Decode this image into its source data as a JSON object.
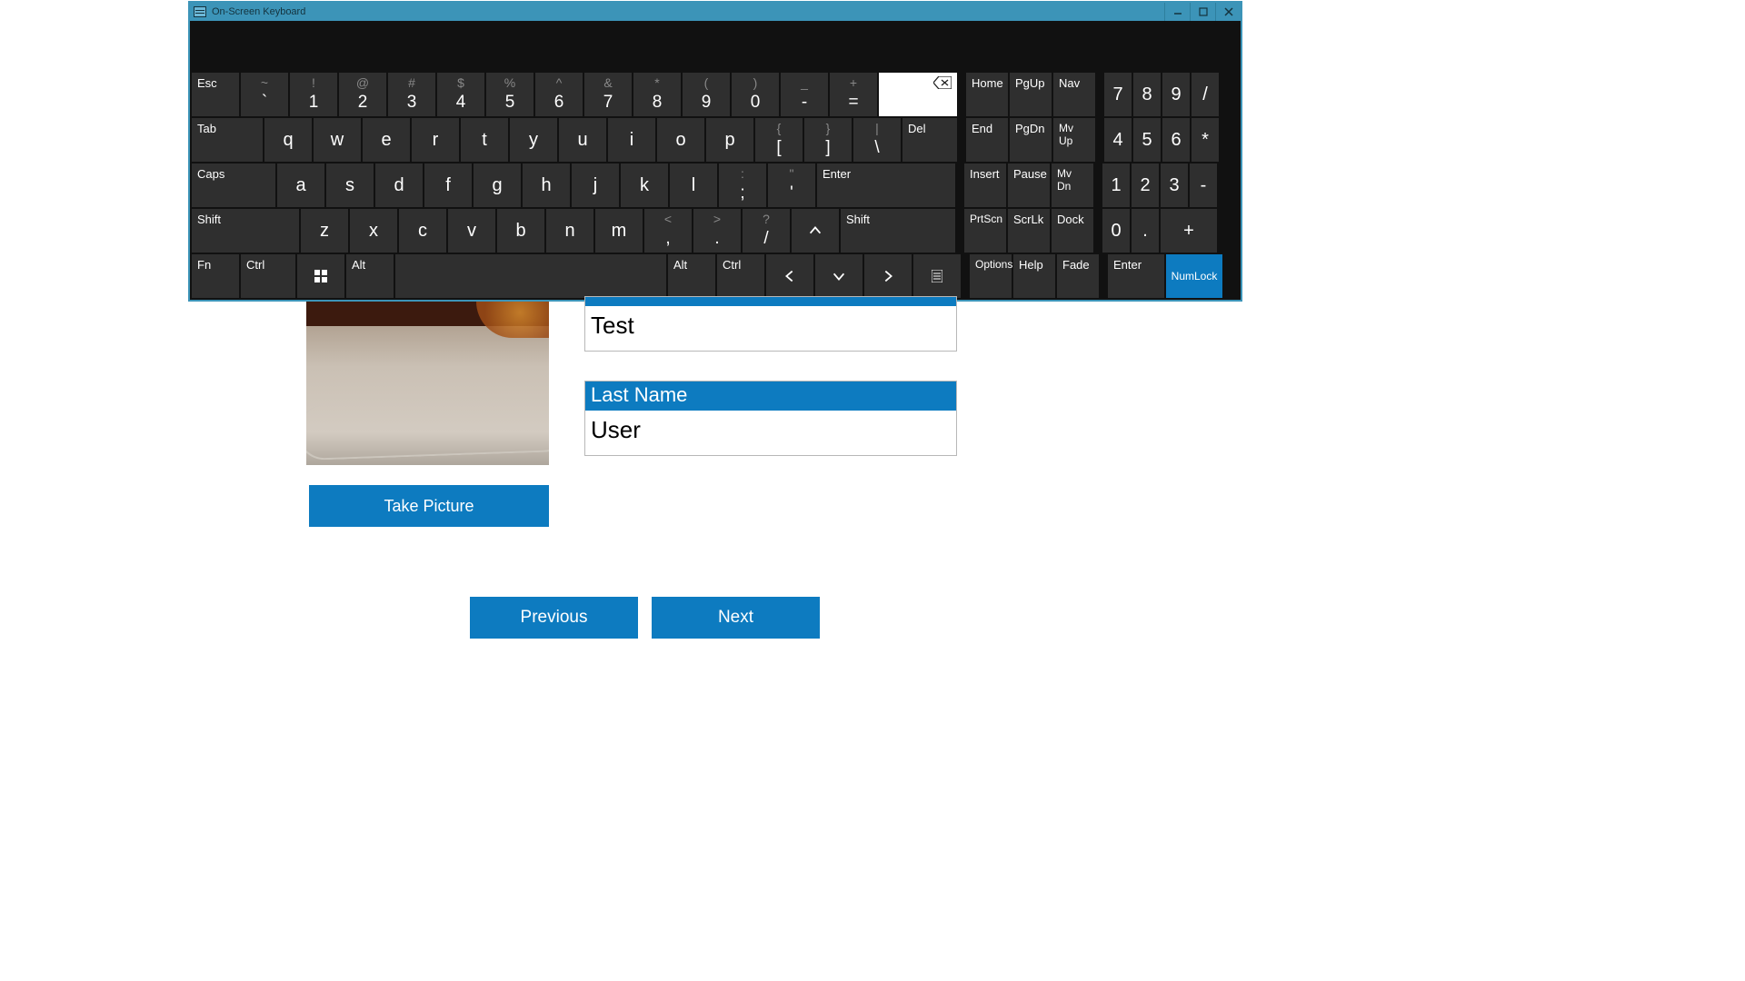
{
  "osk": {
    "title": "On-Screen Keyboard",
    "row1": {
      "esc": "Esc",
      "nums": [
        {
          "top": "~",
          "bot": "`"
        },
        {
          "top": "!",
          "bot": "1"
        },
        {
          "top": "@",
          "bot": "2"
        },
        {
          "top": "#",
          "bot": "3"
        },
        {
          "top": "$",
          "bot": "4"
        },
        {
          "top": "%",
          "bot": "5"
        },
        {
          "top": "^",
          "bot": "6"
        },
        {
          "top": "&",
          "bot": "7"
        },
        {
          "top": "*",
          "bot": "8"
        },
        {
          "top": "(",
          "bot": "9"
        },
        {
          "top": ")",
          "bot": "0"
        },
        {
          "top": "_",
          "bot": "-"
        },
        {
          "top": "+",
          "bot": "="
        }
      ],
      "nav": {
        "home": "Home",
        "pgup": "PgUp",
        "nav": "Nav"
      },
      "np": [
        "7",
        "8",
        "9",
        "/"
      ]
    },
    "row2": {
      "tab": "Tab",
      "letters": [
        "q",
        "w",
        "e",
        "r",
        "t",
        "y",
        "u",
        "i",
        "o",
        "p"
      ],
      "brackets": [
        {
          "top": "{",
          "bot": "["
        },
        {
          "top": "}",
          "bot": "]"
        },
        {
          "top": "|",
          "bot": "\\"
        }
      ],
      "del": "Del",
      "nav": {
        "end": "End",
        "pgdn": "PgDn",
        "mvup": "Mv Up"
      },
      "np": [
        "4",
        "5",
        "6",
        "*"
      ]
    },
    "row3": {
      "caps": "Caps",
      "letters": [
        "a",
        "s",
        "d",
        "f",
        "g",
        "h",
        "j",
        "k",
        "l"
      ],
      "punct": [
        {
          "top": ":",
          "bot": ";"
        },
        {
          "top": "\"",
          "bot": "'"
        }
      ],
      "enter": "Enter",
      "nav": {
        "insert": "Insert",
        "pause": "Pause",
        "mvdn": "Mv Dn"
      },
      "np": [
        "1",
        "2",
        "3",
        "-"
      ]
    },
    "row4": {
      "shiftL": "Shift",
      "letters": [
        "z",
        "x",
        "c",
        "v",
        "b",
        "n",
        "m"
      ],
      "punct": [
        {
          "top": "<",
          "bot": ","
        },
        {
          "top": ">",
          "bot": "."
        },
        {
          "top": "?",
          "bot": "/"
        }
      ],
      "shiftR": "Shift",
      "nav": {
        "prtscn": "PrtScn",
        "scrlk": "ScrLk",
        "dock": "Dock"
      },
      "np": [
        "0",
        ".",
        "+"
      ]
    },
    "row5": {
      "fn": "Fn",
      "ctrlL": "Ctrl",
      "altL": "Alt",
      "altR": "Alt",
      "ctrlR": "Ctrl",
      "nav": {
        "options": "Options",
        "help": "Help",
        "fade": "Fade",
        "enter": "Enter",
        "numlock": "NumLock"
      }
    }
  },
  "form": {
    "take_picture": "Take Picture",
    "first_name_value": "Test",
    "last_name_label": "Last Name",
    "last_name_value": "User",
    "previous": "Previous",
    "next": "Next"
  }
}
